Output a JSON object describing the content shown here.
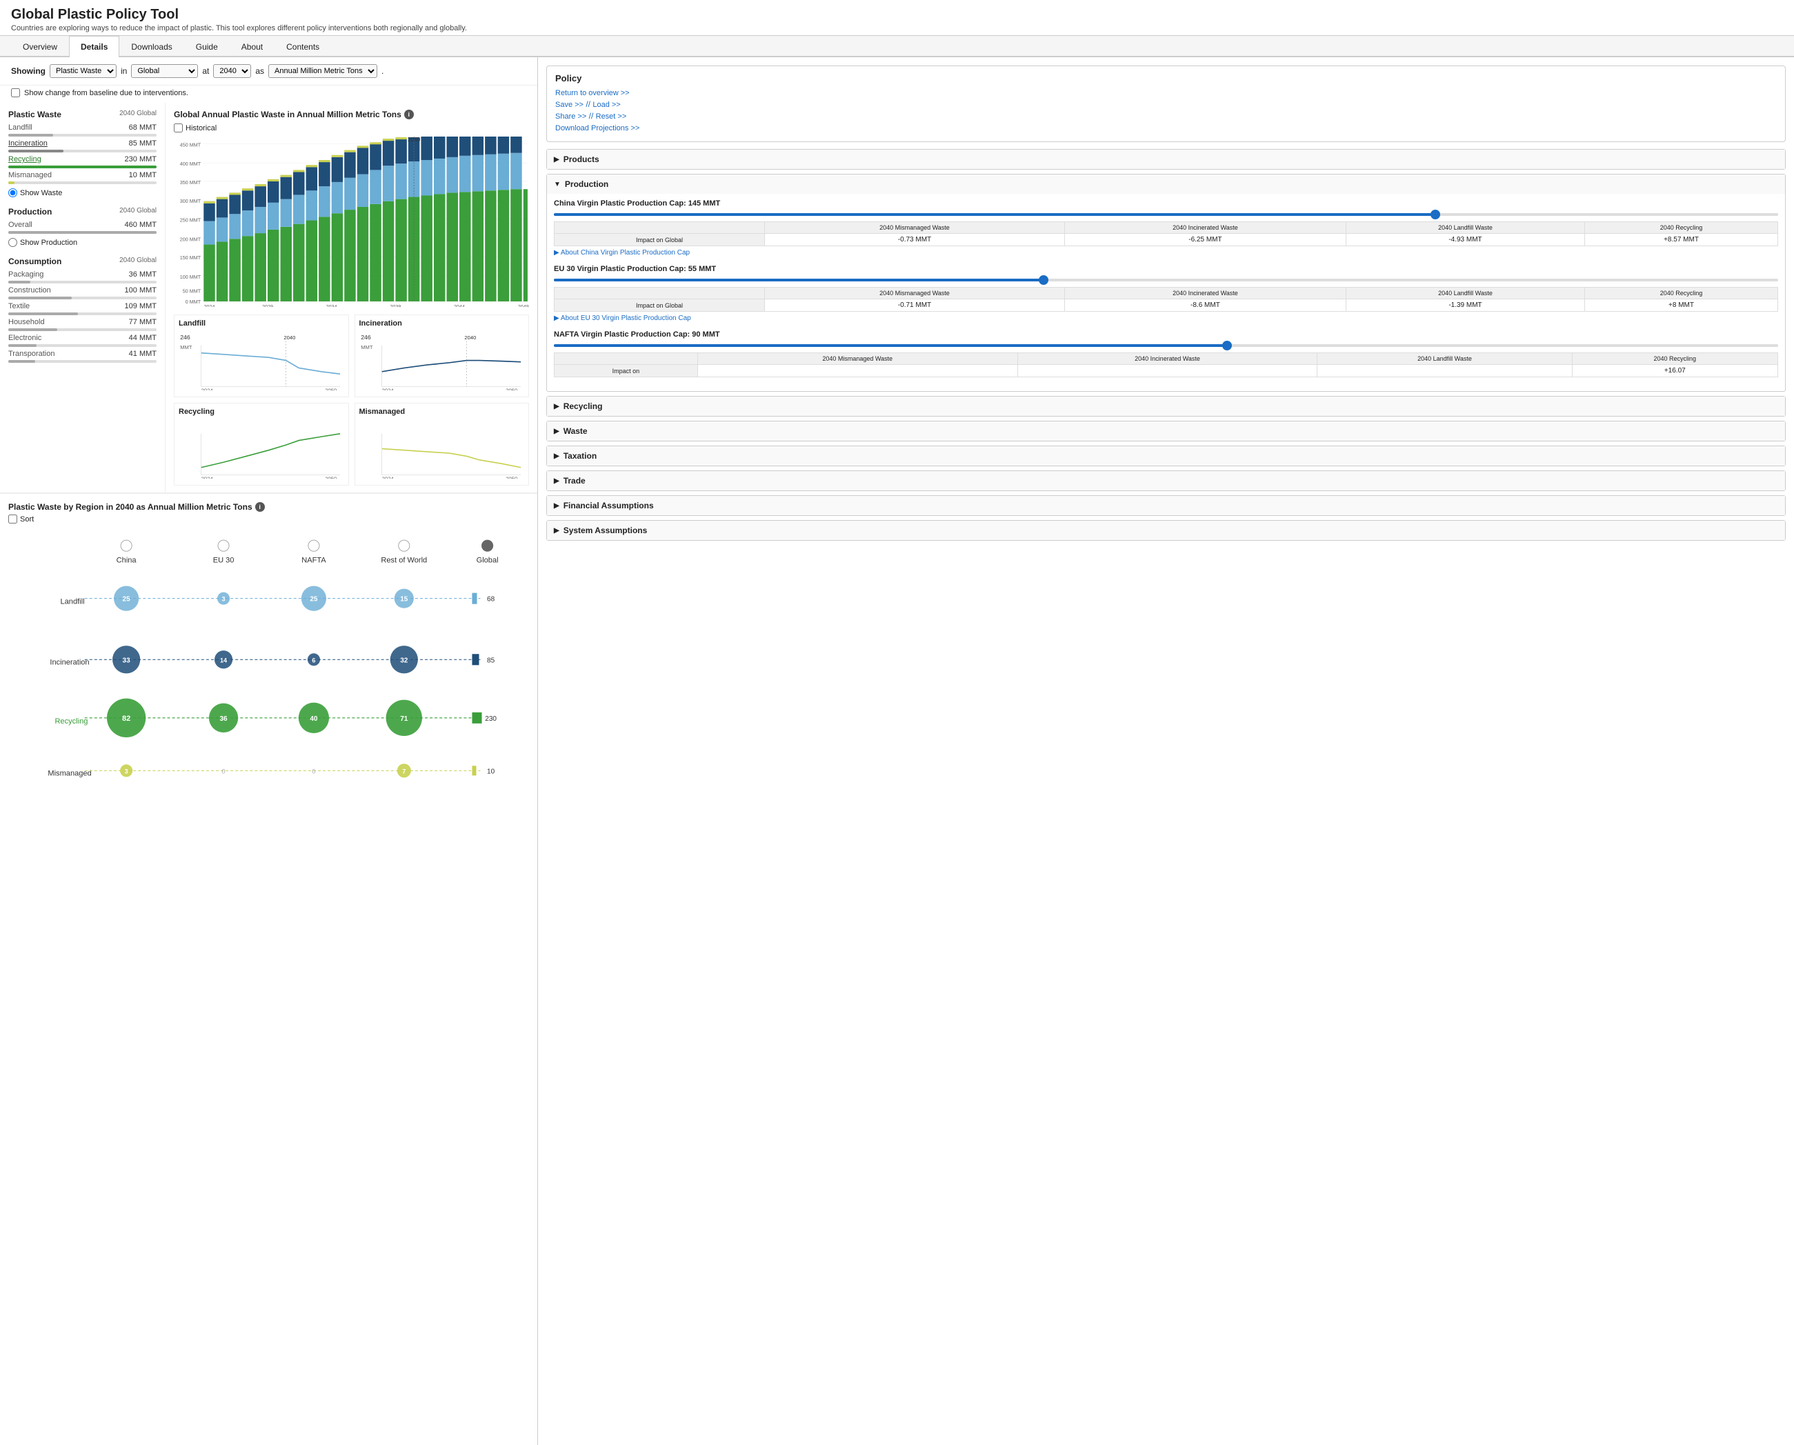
{
  "app": {
    "title": "Global Plastic Policy Tool",
    "subtitle": "Countries are exploring ways to reduce the impact of plastic. This tool explores different policy interventions both regionally and globally."
  },
  "nav": {
    "tabs": [
      "Overview",
      "Details",
      "Downloads",
      "Guide",
      "About",
      "Contents"
    ],
    "active": "Details"
  },
  "showing": {
    "label": "Showing",
    "metric": "Plastic Waste",
    "in_label": "in",
    "region": "Global",
    "at_label": "at",
    "year": "2040",
    "as_label": "as",
    "unit": "Annual Million Metric Tons",
    "dot": ".",
    "change_label": "Show change from baseline due to interventions."
  },
  "plastic_waste": {
    "section_title": "Plastic Waste",
    "section_subtitle": "2040 Global",
    "rows": [
      {
        "label": "Landfill",
        "value": "68 MMT",
        "bar_pct": 30,
        "color": "#aaa"
      },
      {
        "label": "Incineration",
        "value": "85 MMT",
        "bar_pct": 37,
        "color": "#888",
        "underline": true
      },
      {
        "label": "Recycling",
        "value": "230 MMT",
        "bar_pct": 100,
        "color": "#3a9e3a",
        "green": true
      },
      {
        "label": "Mismanaged",
        "value": "10 MMT",
        "bar_pct": 4,
        "color": "#c8d050"
      }
    ],
    "radio_label": "Show Waste"
  },
  "production": {
    "section_title": "Production",
    "section_subtitle": "2040 Global",
    "rows": [
      {
        "label": "Overall",
        "value": "460 MMT",
        "bar_pct": 100,
        "color": "#aaa"
      }
    ],
    "radio_label": "Show Production"
  },
  "consumption": {
    "section_title": "Consumption",
    "section_subtitle": "2040 Global",
    "rows": [
      {
        "label": "Packaging",
        "value": "36 MMT",
        "bar_pct": 15,
        "color": "#aaa"
      },
      {
        "label": "Construction",
        "value": "100 MMT",
        "bar_pct": 43,
        "color": "#aaa"
      },
      {
        "label": "Textile",
        "value": "109 MMT",
        "bar_pct": 47,
        "color": "#aaa"
      },
      {
        "label": "Household",
        "value": "77 MMT",
        "bar_pct": 33,
        "color": "#aaa"
      },
      {
        "label": "Electronic",
        "value": "44 MMT",
        "bar_pct": 19,
        "color": "#aaa"
      },
      {
        "label": "Transporation",
        "value": "41 MMT",
        "bar_pct": 18,
        "color": "#aaa"
      }
    ]
  },
  "main_chart": {
    "title": "Global Annual Plastic Waste in Annual Million Metric Tons",
    "year_marker": "2040",
    "historical_label": "Historical",
    "y_labels": [
      "450 MMT",
      "400 MMT",
      "350 MMT",
      "300 MMT",
      "250 MMT",
      "200 MMT",
      "150 MMT",
      "100 MMT",
      "50 MMT",
      "0 MMT"
    ],
    "x_labels": [
      "2024",
      "2029",
      "2034",
      "2039",
      "2044",
      "2049"
    ],
    "segments": {
      "recycling_color": "#3a9e3a",
      "landfill_color": "#6aadd5",
      "incineration_color": "#1f4e79",
      "mismanaged_color": "#c8d050"
    }
  },
  "small_charts": [
    {
      "title": "Landfill",
      "value_label": "246",
      "unit": "MMT",
      "year_start": "2024",
      "year_end": "2050",
      "year_marker": "2040"
    },
    {
      "title": "Incineration",
      "value_label": "246",
      "unit": "MMT",
      "year_start": "2024",
      "year_end": "2050",
      "year_marker": "2040"
    },
    {
      "title": "Recycling",
      "year_start": "2024",
      "year_end": "2050"
    },
    {
      "title": "Mismanaged",
      "year_start": "2024",
      "year_end": "2050"
    }
  ],
  "region_chart": {
    "title": "Plastic Waste by Region in 2040 as Annual Million Metric Tons",
    "sort_label": "Sort",
    "columns": [
      "China",
      "EU 30",
      "NAFTA",
      "Rest of World",
      "Global"
    ],
    "rows": [
      {
        "label": "Landfill",
        "color": "#6aadd5",
        "values": [
          25,
          3,
          25,
          15,
          68
        ],
        "sizes": [
          36,
          18,
          36,
          28,
          14
        ]
      },
      {
        "label": "Incineration",
        "color": "#1f4e79",
        "values": [
          33,
          14,
          6,
          32,
          85
        ],
        "sizes": [
          40,
          26,
          18,
          40,
          16
        ]
      },
      {
        "label": "Recycling",
        "color": "#3a9e3a",
        "values": [
          82,
          36,
          40,
          71,
          230
        ],
        "sizes": [
          56,
          40,
          42,
          52,
          18
        ]
      },
      {
        "label": "Mismanaged",
        "color": "#c8d050",
        "values": [
          3,
          0,
          0,
          7,
          10
        ],
        "sizes": [
          18,
          0,
          0,
          20,
          12
        ]
      }
    ]
  },
  "policy": {
    "title": "Policy",
    "links": [
      {
        "text": "Return to overview >>",
        "row": 0
      },
      {
        "text": "Save >>",
        "row": 1
      },
      {
        "text": "// Load >>",
        "row": 1
      },
      {
        "text": "Share >>",
        "row": 2
      },
      {
        "text": "// Reset >>",
        "row": 2
      },
      {
        "text": "Download Projections >>",
        "row": 3
      }
    ]
  },
  "accordions": [
    {
      "label": "Products",
      "open": false
    },
    {
      "label": "Production",
      "open": true
    },
    {
      "label": "Recycling",
      "open": false
    },
    {
      "label": "Waste",
      "open": false
    },
    {
      "label": "Taxation",
      "open": false
    },
    {
      "label": "Trade",
      "open": false
    },
    {
      "label": "Financial Assumptions",
      "open": false
    },
    {
      "label": "System Assumptions",
      "open": false
    }
  ],
  "production_caps": [
    {
      "title": "China Virgin Plastic Production Cap: 145 MMT",
      "slider_pct": 72,
      "color": "#1a6cc4",
      "impact_rows": [
        {
          "label": "2040 Mismanaged Waste",
          "value": "-0.73 MMT"
        },
        {
          "label": "2040 Incinerated Waste",
          "value": "-6.25 MMT"
        },
        {
          "label": "2040 Landfill Waste",
          "value": "-4.93 MMT"
        },
        {
          "label": "2040 Recycling",
          "value": "+8.57 MMT"
        }
      ],
      "impact_row_label": "Impact on Global",
      "about_label": "▶ About China Virgin Plastic Production Cap"
    },
    {
      "title": "EU 30 Virgin Plastic Production Cap: 55 MMT",
      "slider_pct": 40,
      "color": "#1a6cc4",
      "impact_rows": [
        {
          "label": "2040 Mismanaged Waste",
          "value": "-0.71 MMT"
        },
        {
          "label": "2040 Incinerated Waste",
          "value": "-8.6 MMT"
        },
        {
          "label": "2040 Landfill Waste",
          "value": "-1.39 MMT"
        },
        {
          "label": "2040 Recycling",
          "value": "+8 MMT"
        }
      ],
      "impact_row_label": "Impact on Global",
      "about_label": "▶ About EU 30 Virgin Plastic Production Cap"
    },
    {
      "title": "NAFTA Virgin Plastic Production Cap: 90 MMT",
      "slider_pct": 55,
      "color": "#1a6cc4",
      "impact_rows": [
        {
          "label": "2040 Mismanaged Waste",
          "value": ""
        },
        {
          "label": "2040 Incinerated Waste",
          "value": ""
        },
        {
          "label": "2040 Landfill Waste",
          "value": ""
        },
        {
          "label": "2040 Recycling",
          "value": "+16.07"
        }
      ],
      "impact_row_label": "Impact on",
      "about_label": ""
    }
  ]
}
